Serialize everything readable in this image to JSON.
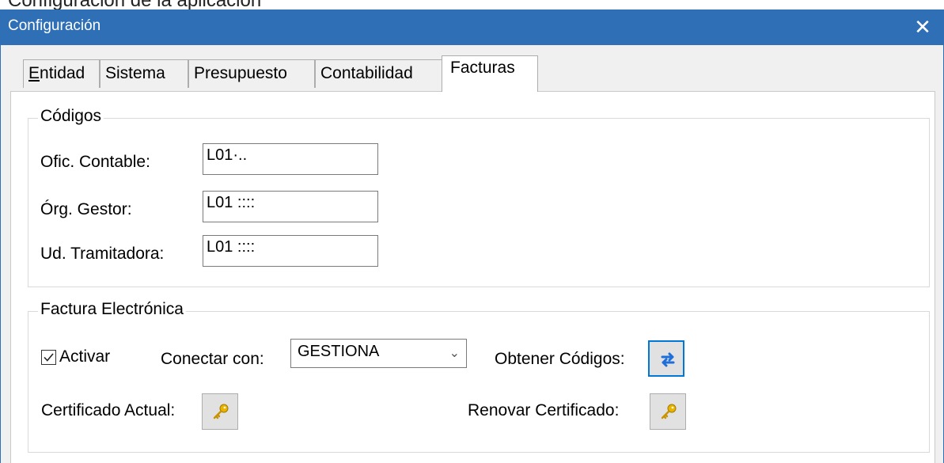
{
  "window": {
    "title": "Configuración",
    "close_glyph": "✕",
    "cropped_heading": "Configuración de la aplicación"
  },
  "tabs": [
    {
      "label_first": "E",
      "label_rest": "ntidad",
      "active": false
    },
    {
      "label": "Sistema",
      "active": false
    },
    {
      "label": "Presupuesto",
      "active": false
    },
    {
      "label": "Contabilidad",
      "active": false
    },
    {
      "label": "Facturas",
      "active": true
    }
  ],
  "codigos": {
    "legend": "Códigos",
    "ofic_contable": {
      "label": "Ofic. Contable:",
      "value": "L01·.."
    },
    "org_gestor": {
      "label": "Órg. Gestor:",
      "value": "L01 ::::"
    },
    "ud_tramitadora": {
      "label": "Ud. Tramitadora:",
      "value": "L01 ::::"
    }
  },
  "factura": {
    "legend": "Factura Electrónica",
    "activar_label": "Activar",
    "activar_checked": true,
    "conectar_label": "Conectar con:",
    "conectar_value": "GESTIONA",
    "obtener_label": "Obtener Códigos:",
    "obtener_icon": "sync-arrows-icon",
    "certificado_label": "Certificado Actual:",
    "certificado_icon": "key-icon",
    "renovar_label": "Renovar Certificado:",
    "renovar_icon": "key-icon"
  },
  "colors": {
    "titlebar": "#2f6fb6",
    "accent": "#0078d7",
    "key": "#e8b400"
  }
}
